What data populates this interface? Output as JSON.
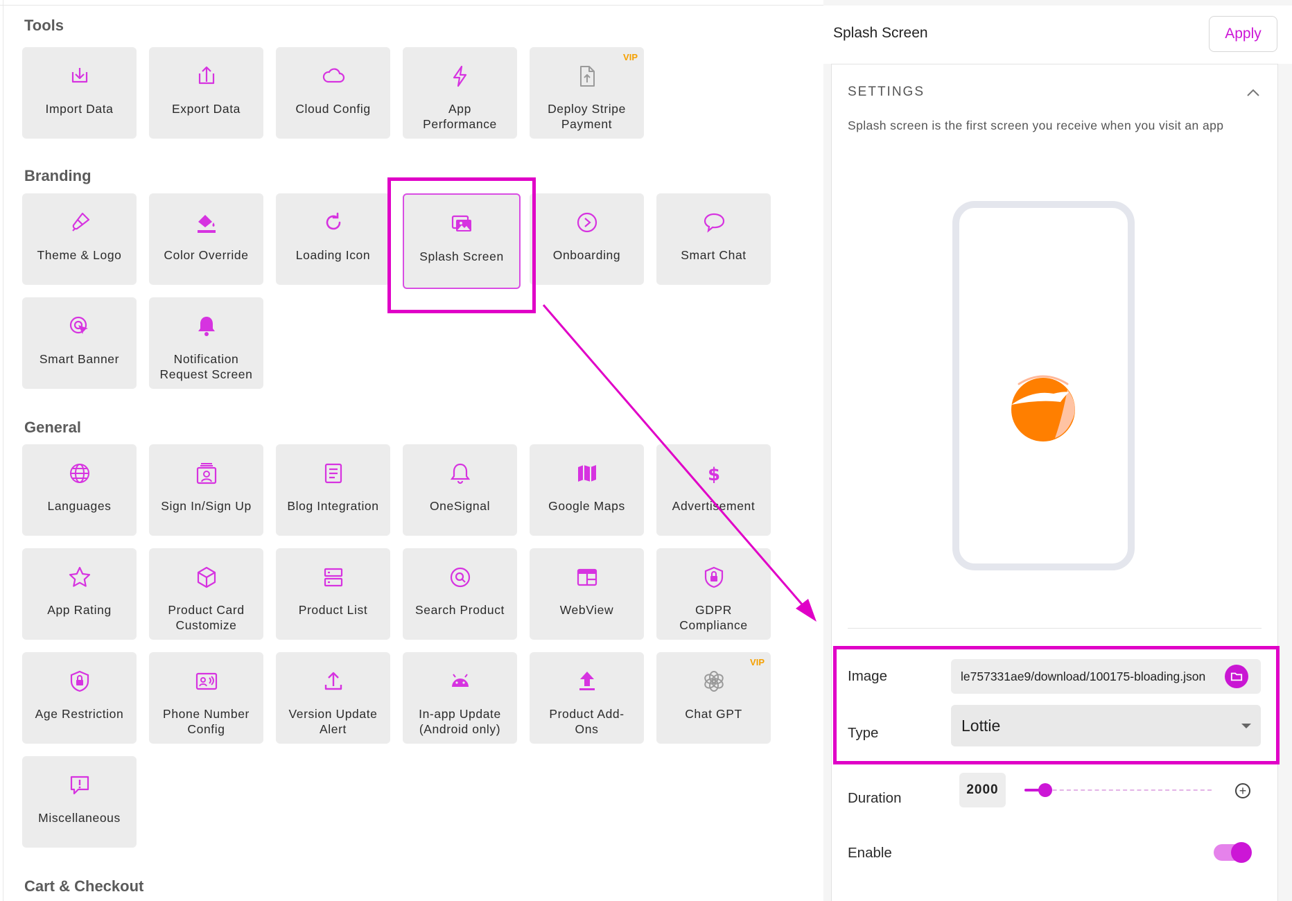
{
  "sections": {
    "tools": "Tools",
    "branding": "Branding",
    "general": "General",
    "cart": "Cart & Checkout"
  },
  "tools": [
    {
      "label": "Import Data",
      "icon": "import-icon"
    },
    {
      "label": "Export Data",
      "icon": "export-icon"
    },
    {
      "label": "Cloud Config",
      "icon": "cloud-icon"
    },
    {
      "label": "App\nPerformance",
      "icon": "lightning-icon"
    },
    {
      "label": "Deploy Stripe\nPayment",
      "icon": "file-upload-icon",
      "badge": "VIP"
    }
  ],
  "branding": [
    {
      "label": "Theme & Logo",
      "icon": "paintbrush-icon"
    },
    {
      "label": "Color Override",
      "icon": "paint-bucket-icon"
    },
    {
      "label": "Loading Icon",
      "icon": "refresh-icon"
    },
    {
      "label": "Splash Screen",
      "icon": "images-icon"
    },
    {
      "label": "Onboarding",
      "icon": "play-circle-icon"
    },
    {
      "label": "Smart Chat",
      "icon": "chat-bubble-icon"
    },
    {
      "label": "Smart Banner",
      "icon": "cursor-target-icon"
    },
    {
      "label": "Notification\nRequest Screen",
      "icon": "bell-icon"
    }
  ],
  "general": [
    {
      "label": "Languages",
      "icon": "globe-icon"
    },
    {
      "label": "Sign In/Sign Up",
      "icon": "user-card-icon"
    },
    {
      "label": "Blog Integration",
      "icon": "document-icon"
    },
    {
      "label": "OneSignal",
      "icon": "bell-outline-icon"
    },
    {
      "label": "Google Maps",
      "icon": "map-icon"
    },
    {
      "label": "Advertisement",
      "icon": "dollar-icon"
    },
    {
      "label": "App Rating",
      "icon": "star-icon"
    },
    {
      "label": "Product Card\nCustomize",
      "icon": "cube-icon"
    },
    {
      "label": "Product List",
      "icon": "list-server-icon"
    },
    {
      "label": "Search Product",
      "icon": "search-icon"
    },
    {
      "label": "WebView",
      "icon": "browser-window-icon"
    },
    {
      "label": "GDPR\nCompliance",
      "icon": "shield-lock-icon"
    },
    {
      "label": "Age Restriction",
      "icon": "shield-lock-icon"
    },
    {
      "label": "Phone Number\nConfig",
      "icon": "phone-card-icon"
    },
    {
      "label": "Version Update\nAlert",
      "icon": "upload-icon"
    },
    {
      "label": "In-app Update\n(Android only)",
      "icon": "android-icon"
    },
    {
      "label": "Product Add-\nOns",
      "icon": "upload-arrow-icon"
    },
    {
      "label": "Chat GPT",
      "icon": "openai-icon",
      "badge": "VIP"
    },
    {
      "label": "Miscellaneous",
      "icon": "alert-message-icon"
    }
  ],
  "panel": {
    "title": "Splash Screen",
    "apply": "Apply",
    "settings_title": "SETTINGS",
    "description": "Splash screen is the first screen you receive when you visit an app",
    "image_label": "Image",
    "image_value": "le757331ae9/download/100175-bloading.json",
    "type_label": "Type",
    "type_value": "Lottie",
    "duration_label": "Duration",
    "duration_value": "2000",
    "enable_label": "Enable",
    "enable_value": true,
    "duration_slider_fraction": 0.1
  },
  "colors": {
    "accent": "#cc16d6",
    "highlight": "#e000c7",
    "vip": "#f5a000",
    "loader": "#ff7f00"
  }
}
